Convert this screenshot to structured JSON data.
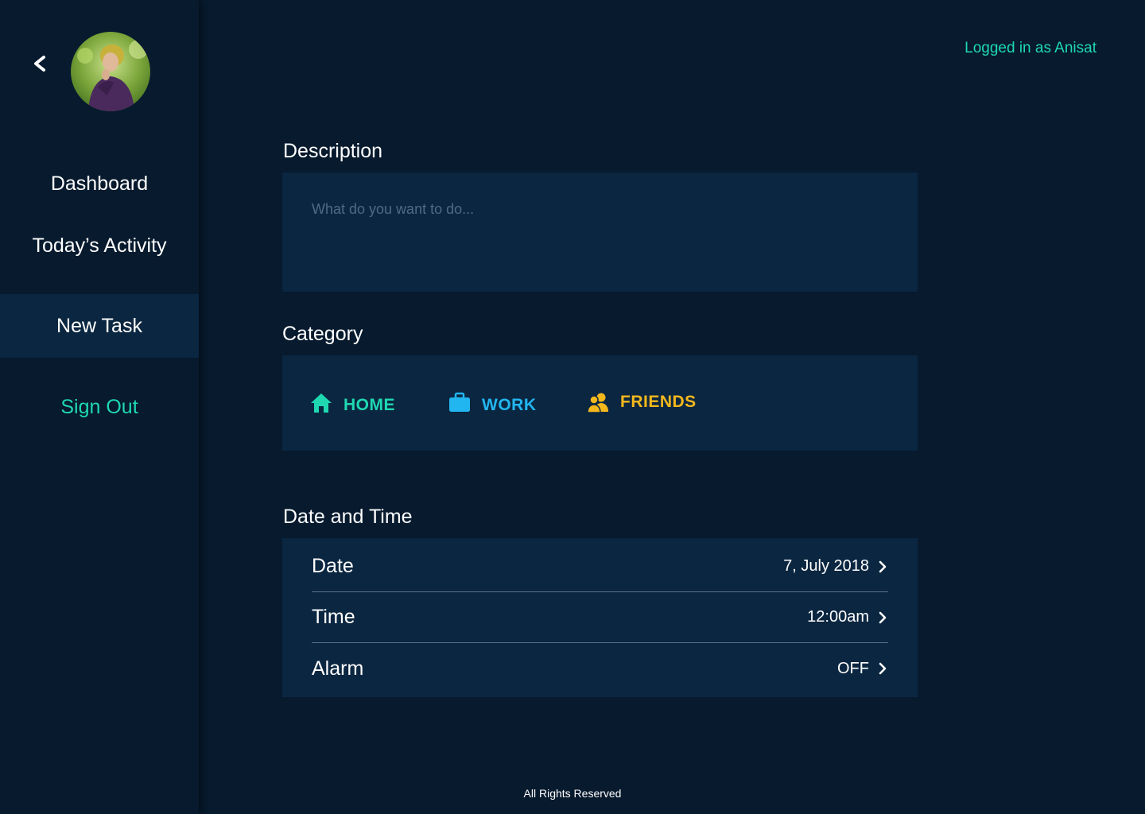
{
  "header": {
    "logged_in_text": "Logged in as Anisat"
  },
  "sidebar": {
    "items": [
      {
        "label": "Dashboard"
      },
      {
        "label": "Today’s Activity"
      },
      {
        "label": "New Task"
      },
      {
        "label": "Sign Out"
      }
    ]
  },
  "form": {
    "description": {
      "title": "Description",
      "value": "",
      "placeholder": "What do you want to do..."
    },
    "category": {
      "title": "Category",
      "options": [
        {
          "label": "HOME",
          "icon": "home-icon",
          "color": "#1fd8b2"
        },
        {
          "label": "WORK",
          "icon": "briefcase-icon",
          "color": "#22b6f0"
        },
        {
          "label": "FRIENDS",
          "icon": "friends-icon",
          "color": "#f5b81c"
        }
      ]
    },
    "datetime": {
      "title": "Date and Time",
      "rows": [
        {
          "label": "Date",
          "value": "7, July 2018"
        },
        {
          "label": "Time",
          "value": "12:00am"
        },
        {
          "label": "Alarm",
          "value": "OFF"
        }
      ]
    }
  },
  "footer": {
    "text": "All Rights Reserved"
  }
}
